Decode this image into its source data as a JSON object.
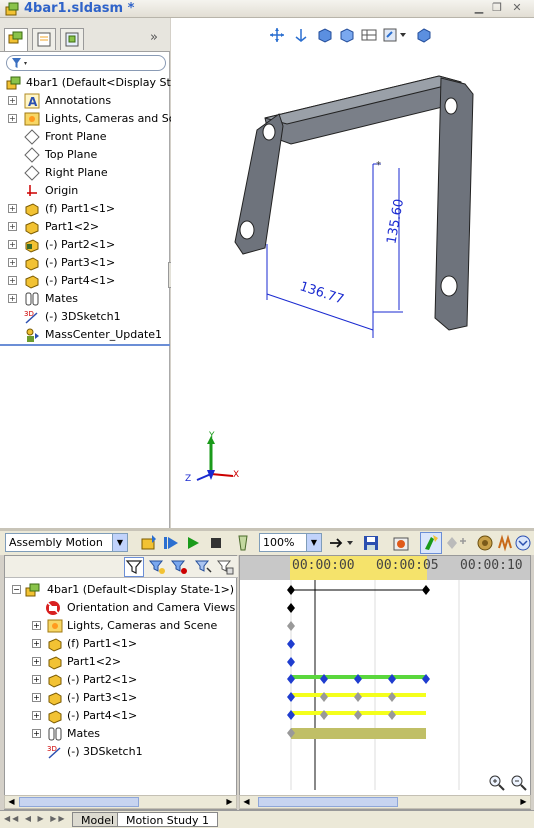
{
  "window": {
    "title": "4bar1.sldasm *"
  },
  "feature_tree": {
    "filter_placeholder": "",
    "items": [
      {
        "label": "4bar1  (Default<Display State",
        "icon": "assembly-icon"
      },
      {
        "label": "Annotations",
        "icon": "annotations-icon"
      },
      {
        "label": "Lights, Cameras and Scer",
        "icon": "lights-icon"
      },
      {
        "label": "Front Plane",
        "icon": "plane-icon"
      },
      {
        "label": "Top Plane",
        "icon": "plane-icon"
      },
      {
        "label": "Right Plane",
        "icon": "plane-icon"
      },
      {
        "label": "Origin",
        "icon": "origin-icon"
      },
      {
        "label": "(f) Part1<1>",
        "icon": "part-icon"
      },
      {
        "label": "Part1<2>",
        "icon": "part-icon"
      },
      {
        "label": "(-) Part2<1>",
        "icon": "part-icon"
      },
      {
        "label": "(-) Part3<1>",
        "icon": "part-icon"
      },
      {
        "label": "(-) Part4<1>",
        "icon": "part-icon"
      },
      {
        "label": "Mates",
        "icon": "mates-icon"
      },
      {
        "label": "(-) 3DSketch1",
        "icon": "sketch3d-icon"
      },
      {
        "label": "MassCenter_Update1",
        "icon": "masscenter-icon"
      }
    ]
  },
  "viewport": {
    "dimension_horizontal": "136.77",
    "dimension_vertical": "135.60",
    "triad": {
      "x": "X",
      "y": "Y",
      "z": "Z"
    }
  },
  "motion_toolbar": {
    "study_type": "Assembly Motion",
    "zoom": "100%"
  },
  "motion_tree": {
    "items": [
      {
        "label": "4bar1  (Default<Display State-1>)",
        "icon": "assembly-icon"
      },
      {
        "label": "Orientation and Camera Views",
        "icon": "camera-views-icon"
      },
      {
        "label": "Lights, Cameras and Scene",
        "icon": "lights-icon"
      },
      {
        "label": "(f) Part1<1>",
        "icon": "part-icon"
      },
      {
        "label": "Part1<2>",
        "icon": "part-icon"
      },
      {
        "label": "(-) Part2<1>",
        "icon": "part-icon"
      },
      {
        "label": "(-) Part3<1>",
        "icon": "part-icon"
      },
      {
        "label": "(-) Part4<1>",
        "icon": "part-icon"
      },
      {
        "label": "Mates",
        "icon": "mates-icon"
      },
      {
        "label": "(-) 3DSketch1",
        "icon": "sketch3d-icon"
      }
    ]
  },
  "timeline": {
    "time_labels": [
      "00:00:00",
      "00:00:05",
      "00:00:10"
    ],
    "playhead_seconds": 1.5,
    "colors": {
      "part2_bar": "#5ad73d",
      "part3_bar": "#f4ff1c",
      "part4_bar": "#f4ff1c",
      "mates_bar": "#c0bf66",
      "key_blue": "#1f3dcf"
    }
  },
  "bottom_tabs": {
    "model": "Model",
    "motion_study": "Motion Study 1"
  }
}
